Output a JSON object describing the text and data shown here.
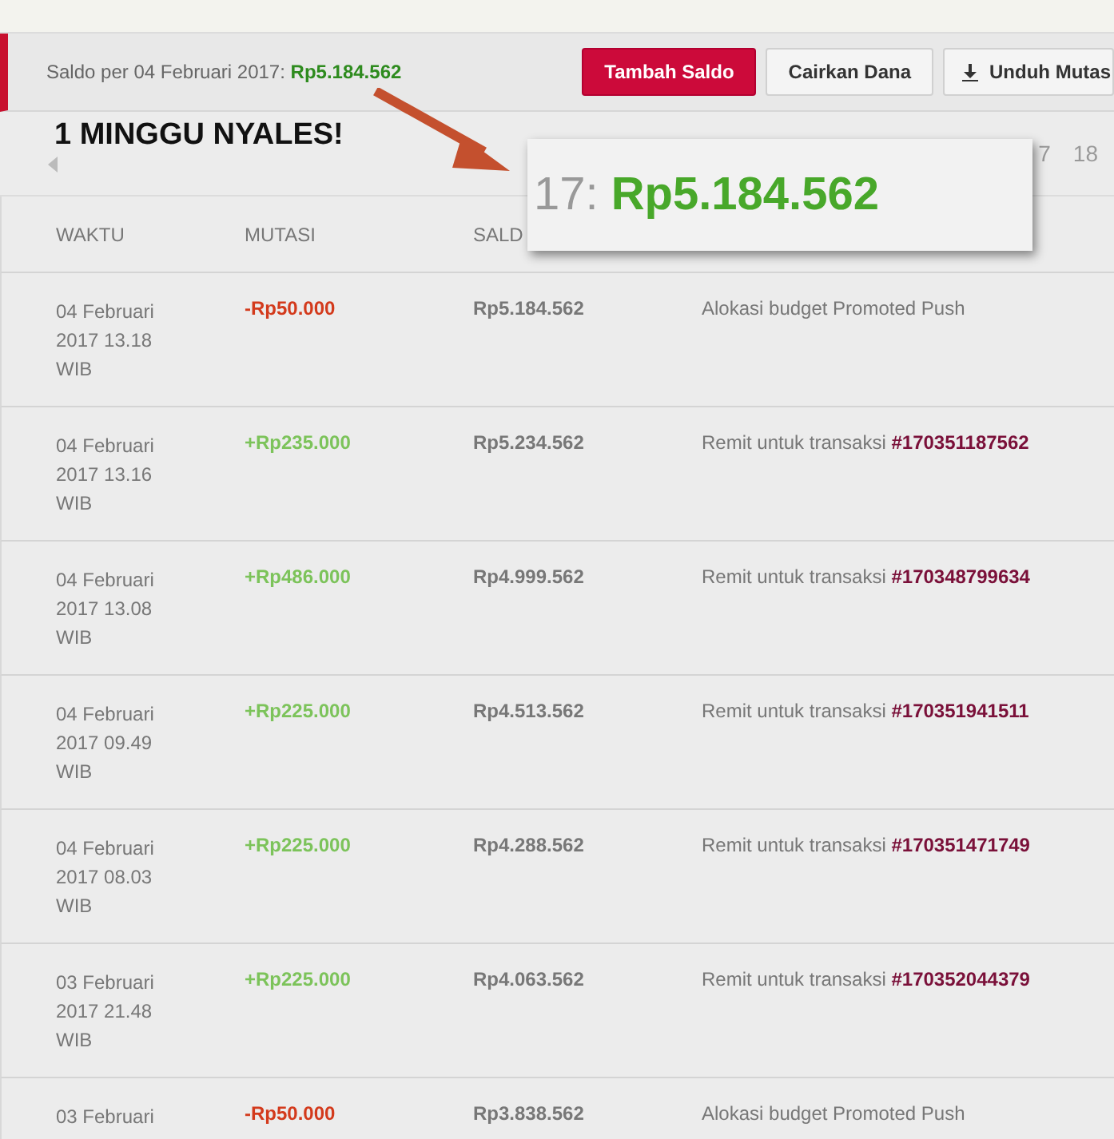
{
  "balance_bar": {
    "label": "Saldo per 04 Februari 2017:",
    "amount": "Rp5.184.562",
    "buttons": [
      {
        "label": "Tambah Saldo",
        "kind": "primary"
      },
      {
        "label": "Cairkan Dana",
        "kind": "secondary"
      },
      {
        "label": "Unduh Mutas",
        "kind": "download"
      }
    ]
  },
  "pagination": {
    "pages": [
      "7",
      "18"
    ]
  },
  "annotation": {
    "caption": "1 MINGGU NYALES!",
    "callout_prefix": "17:",
    "callout_amount": "Rp5.184.562"
  },
  "table": {
    "columns": [
      "WAKTU",
      "MUTASI",
      "SALD"
    ],
    "rows": [
      {
        "time": "04 Februari 2017 13.18 WIB",
        "mutation": "-Rp50.000",
        "kind": "debit",
        "balance": "Rp5.184.562",
        "note": "Alokasi budget Promoted Push"
      },
      {
        "time": "04 Februari 2017 13.16 WIB",
        "mutation": "+Rp235.000",
        "kind": "credit",
        "balance": "Rp5.234.562",
        "note": "Remit untuk transaksi **#170351187562**"
      },
      {
        "time": "04 Februari 2017 13.08 WIB",
        "mutation": "+Rp486.000",
        "kind": "credit",
        "balance": "Rp4.999.562",
        "note": "Remit untuk transaksi **#170348799634**"
      },
      {
        "time": "04 Februari 2017 09.49 WIB",
        "mutation": "+Rp225.000",
        "kind": "credit",
        "balance": "Rp4.513.562",
        "note": "Remit untuk transaksi **#170351941511**"
      },
      {
        "time": "04 Februari 2017 08.03 WIB",
        "mutation": "+Rp225.000",
        "kind": "credit",
        "balance": "Rp4.288.562",
        "note": "Remit untuk transaksi **#170351471749**"
      },
      {
        "time": "03 Februari 2017 21.48 WIB",
        "mutation": "+Rp225.000",
        "kind": "credit",
        "balance": "Rp4.063.562",
        "note": "Remit untuk transaksi **#170352044379**"
      },
      {
        "time": "03 Februari",
        "mutation": "-Rp50.000",
        "kind": "debit",
        "balance": "Rp3.838.562",
        "note": "Alokasi budget Promoted Push"
      }
    ]
  }
}
